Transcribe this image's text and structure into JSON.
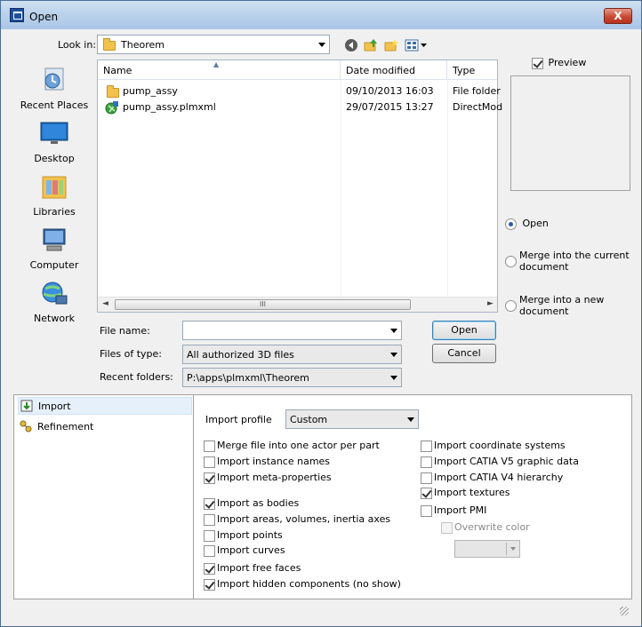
{
  "window": {
    "title": "Open",
    "close_label": "X"
  },
  "toolbar": {
    "look_in_label": "Look in:",
    "look_in_value": "Theorem"
  },
  "places": [
    "Recent Places",
    "Desktop",
    "Libraries",
    "Computer",
    "Network"
  ],
  "file_list": {
    "columns": [
      "Name",
      "Date modified",
      "Type"
    ],
    "rows": [
      {
        "name": "pump_assy",
        "date": "09/10/2013 16:03",
        "type": "File folder",
        "icon": "folder-icon"
      },
      {
        "name": "pump_assy.plmxml",
        "date": "29/07/2015 13:27",
        "type": "DirectMod",
        "icon": "plmxml-file-icon"
      }
    ],
    "scroll_thumb": "III"
  },
  "form": {
    "file_name_label": "File name:",
    "file_name_value": "",
    "files_of_type_label": "Files of type:",
    "files_of_type_value": "All authorized 3D files",
    "recent_folders_label": "Recent folders:",
    "recent_folders_value": "P:\\apps\\plmxml\\Theorem"
  },
  "buttons": {
    "open": "Open",
    "cancel": "Cancel"
  },
  "preview": {
    "label": "Preview",
    "checked": true
  },
  "mode": {
    "open": "Open",
    "merge_current": [
      "Merge into the current",
      "document"
    ],
    "merge_new": [
      "Merge into a new",
      "document"
    ],
    "selected": "open"
  },
  "tree": {
    "items": [
      "Import",
      "Refinement"
    ],
    "selected": "Import"
  },
  "import": {
    "profile_label": "Import profile",
    "profile_value": "Custom",
    "left_options": [
      {
        "label": "Merge file into one actor per part",
        "checked": false
      },
      {
        "label": "Import instance names",
        "checked": false
      },
      {
        "label": "Import meta-properties",
        "checked": true
      },
      {
        "label": "Import as bodies",
        "checked": true
      },
      {
        "label": "Import areas, volumes, inertia axes",
        "checked": false
      },
      {
        "label": "Import points",
        "checked": false
      },
      {
        "label": "Import curves",
        "checked": false
      },
      {
        "label": "Import free faces",
        "checked": true
      },
      {
        "label": "Import hidden components (no show)",
        "checked": true
      }
    ],
    "right_options": [
      {
        "label": "Import coordinate systems",
        "checked": false
      },
      {
        "label": "Import CATIA V5 graphic data",
        "checked": false
      },
      {
        "label": "Import CATIA V4 hierarchy",
        "checked": false
      },
      {
        "label": "Import textures",
        "checked": true
      },
      {
        "label": "Import PMI",
        "checked": false
      }
    ],
    "overwrite_color_label": "Overwrite color",
    "overwrite_color_checked": false
  },
  "colors": {
    "accent": "#3c7fb1",
    "titlebar": "#b9d1ea",
    "selection": "#e5f0fb"
  }
}
